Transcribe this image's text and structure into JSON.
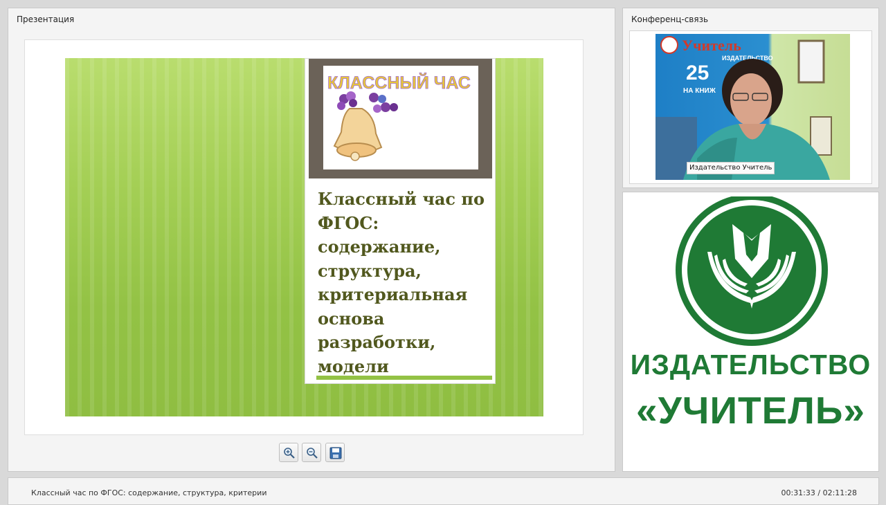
{
  "presentation": {
    "panel_title": "Презентация",
    "slide": {
      "banner_text": "КЛАССНЫЙ ЧАС",
      "heading": "Классный час по\nФГОС:\nсодержание,\nструктура,\nкритериальная\nоснова\nразработки,\nмодели"
    },
    "controls": [
      {
        "name": "zoom-in",
        "icon": "zoom-in-icon"
      },
      {
        "name": "zoom-out",
        "icon": "zoom-out-icon"
      },
      {
        "name": "save",
        "icon": "floppy-disk-icon"
      }
    ]
  },
  "conference": {
    "panel_title": "Конференц-связь",
    "participant_name": "Издательство Учитель",
    "backdrop_text": "Учитель",
    "backdrop_subtext": "ИЗДАТЕЛЬСТВО",
    "backdrop_number": "25",
    "backdrop_caption": "НА КНИЖ"
  },
  "logo": {
    "line1": "ИЗДАТЕЛЬСТВО",
    "line2": "«УЧИТЕЛЬ»",
    "color": "#1f7a35"
  },
  "footer": {
    "title": "Классный час по ФГОС: содержание, структура, критерии",
    "time": "00:31:33 / 02:11:28"
  },
  "colors": {
    "slide_green": "#a4cf55",
    "heading_olive": "#51581e",
    "brand_green": "#1f7a35"
  }
}
